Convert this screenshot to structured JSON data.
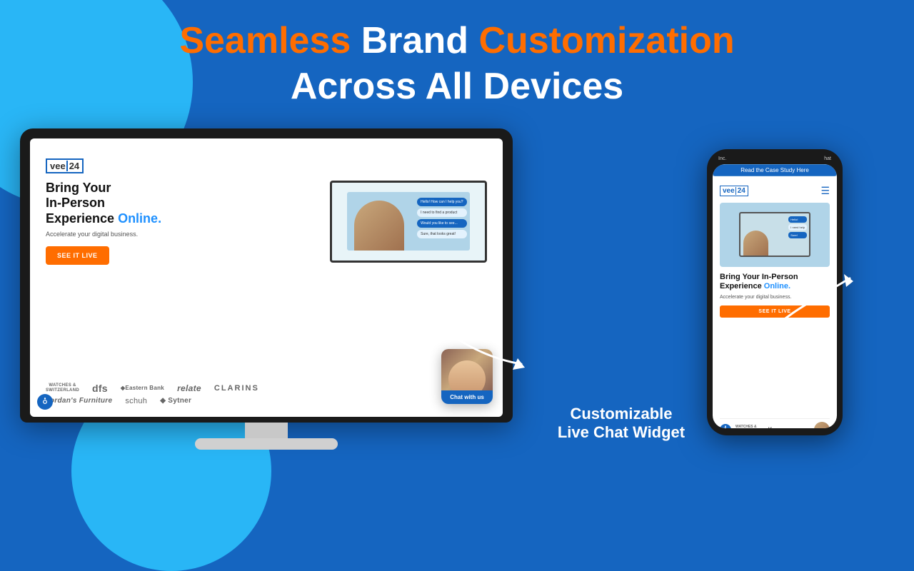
{
  "header": {
    "line1_part1": "Seamless ",
    "line1_part2": "Brand ",
    "line1_part3": "Customization",
    "line2": "Across All Devices"
  },
  "desktop_site": {
    "logo_vee": "vee",
    "logo_24": "24",
    "hero_heading_line1": "Bring Your",
    "hero_heading_line2": "In-Person",
    "hero_heading_line3": "Experience ",
    "hero_heading_highlight": "Online.",
    "hero_subtext": "Accelerate your digital business.",
    "cta_button": "SEE IT LIVE",
    "brands": [
      "WATCHES &\nSWITZERLAND",
      "dfs",
      "◆Eastern Bank",
      "relate",
      "CLARINS",
      "Jordan's\nFurniture",
      "schuh",
      "◆ Sytner"
    ]
  },
  "chat_widget": {
    "label": "Chat with\nus"
  },
  "phone_site": {
    "logo_vee": "vee",
    "logo_24": "24",
    "case_study_bar": "Read the Case Study Here",
    "hero_heading_line1": "Bring Your In-Person",
    "hero_heading_line2": "Experience ",
    "hero_heading_highlight": "Online.",
    "hero_subtext": "Accelerate your digital business.",
    "cta_button": "SEE IT LIVE",
    "brands": [
      "WATCHES &\nSWITZERLAND",
      "dfs"
    ]
  },
  "label": {
    "line1": "Customizable",
    "line2": "Live Chat Widget"
  }
}
